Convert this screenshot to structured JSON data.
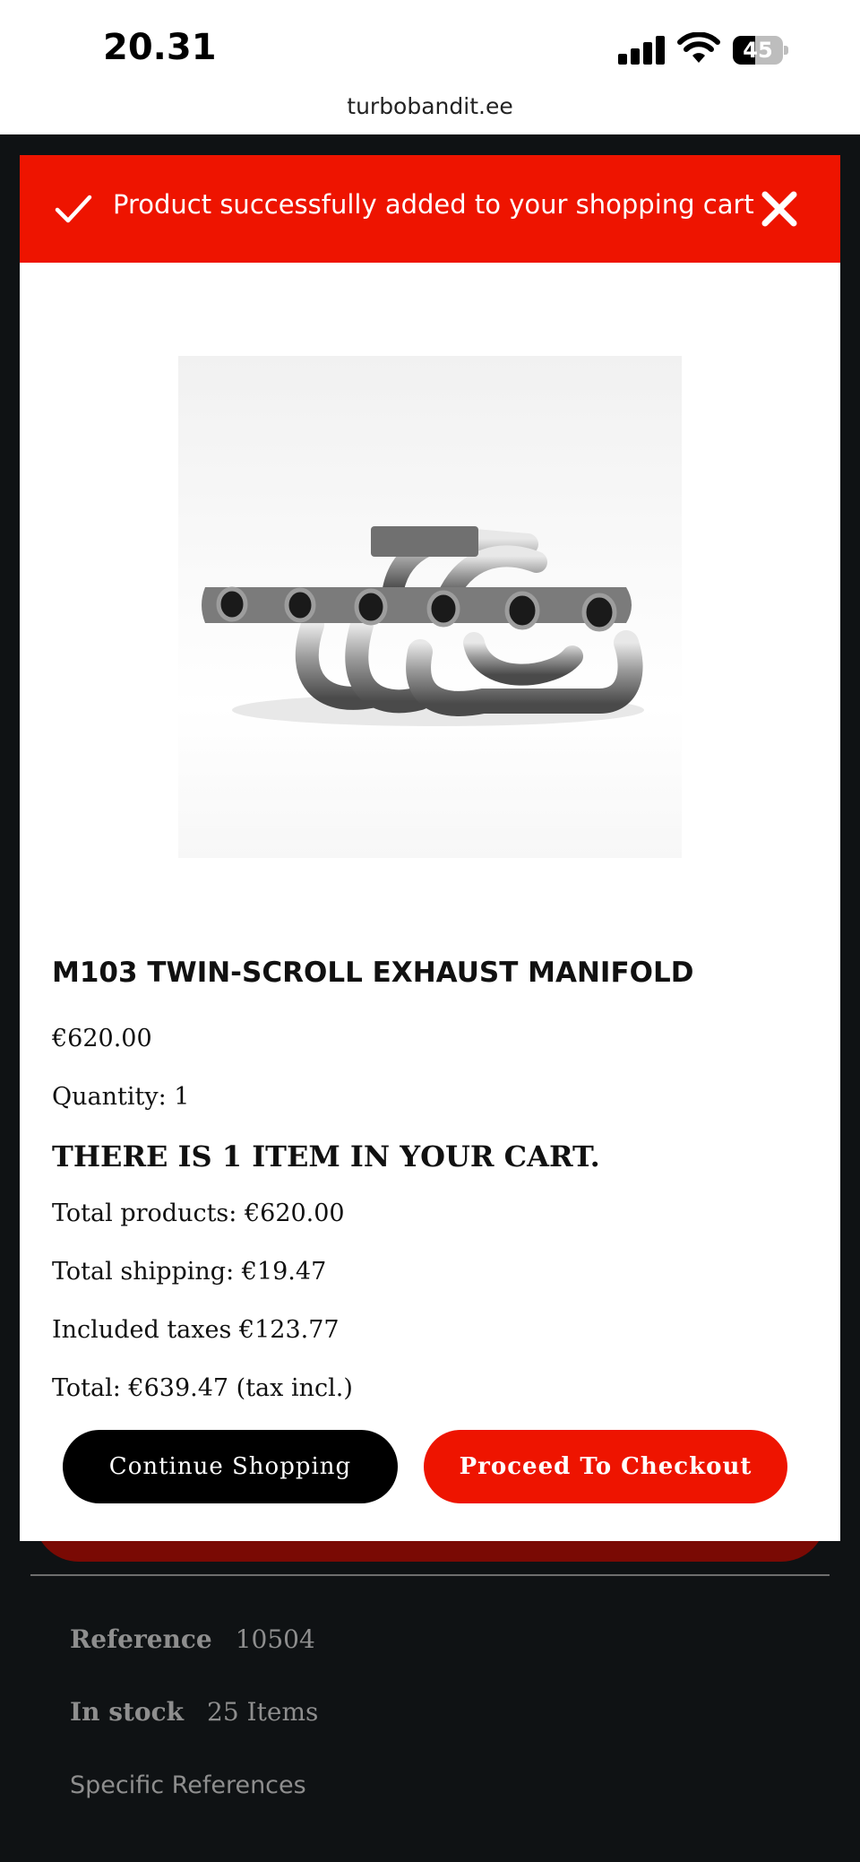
{
  "status_bar": {
    "time": "20.31",
    "battery_level": "45",
    "battery_fraction": 0.45
  },
  "browser": {
    "url": "turbobandit.ee"
  },
  "modal": {
    "title": "Product successfully added to your shopping cart",
    "product": {
      "name": "M103 TWIN-SCROLL EXHAUST MANIFOLD",
      "price": "€620.00",
      "quantity": "Quantity: 1"
    },
    "cart": {
      "count_text": "THERE IS 1 ITEM IN YOUR CART.",
      "total_products": "Total products: €620.00",
      "total_shipping": "Total shipping: €19.47",
      "included_taxes": "Included taxes €123.77",
      "total": "Total: €639.47 (tax incl.)"
    },
    "buttons": {
      "continue_label": "Continue Shopping",
      "checkout_label": "Proceed To Checkout"
    }
  },
  "page": {
    "reference_label": "Reference",
    "reference_value": "10504",
    "stock_label": "In stock",
    "stock_value": "25 Items",
    "specific_refs": "Specific References"
  },
  "colors": {
    "accent": "#ee1400",
    "background": "#0f1214",
    "dark_red": "#7a0a04"
  }
}
